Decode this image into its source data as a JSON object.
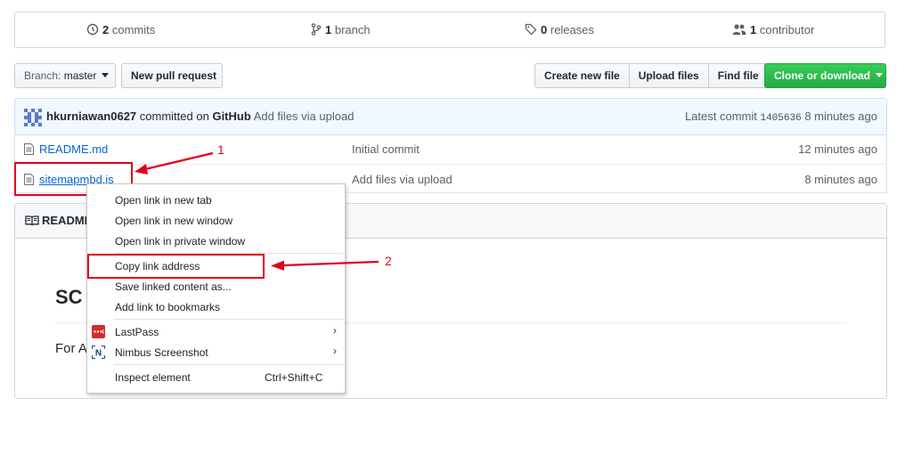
{
  "stats": {
    "commits_count": "2",
    "commits_label": "commits",
    "branches_count": "1",
    "branches_label": "branch",
    "releases_count": "0",
    "releases_label": "releases",
    "contributors_count": "1",
    "contributors_label": "contributor"
  },
  "toolbar": {
    "branch_prefix": "Branch:",
    "branch_name": "master",
    "new_pull_request": "New pull request",
    "create_new_file": "Create new file",
    "upload_files": "Upload files",
    "find_file": "Find file",
    "clone_or_download": "Clone or download"
  },
  "commit": {
    "author": "hkurniawan0627",
    "committed_on": "committed on",
    "platform": "GitHub",
    "message": "Add files via upload",
    "latest_label": "Latest commit",
    "sha": "1405636",
    "age": "8 minutes ago"
  },
  "files": [
    {
      "name": "README.md",
      "message": "Initial commit",
      "age": "12 minutes ago"
    },
    {
      "name": "sitemapmbd.js",
      "message": "Add files via upload",
      "age": "8 minutes ago"
    }
  ],
  "readme": {
    "header": "README",
    "heading_partial": "SC",
    "text_partial": "For A"
  },
  "context_menu": {
    "items": [
      "Open link in new tab",
      "Open link in new window",
      "Open link in private window",
      "Copy link address",
      "Save linked content as...",
      "Add link to bookmarks",
      "LastPass",
      "Nimbus Screenshot",
      "Inspect element"
    ],
    "inspect_shortcut": "Ctrl+Shift+C"
  },
  "annotations": {
    "label_1": "1",
    "label_2": "2",
    "color": "#e0001a"
  },
  "colors": {
    "link": "#0366d6",
    "green_button": "#28a745",
    "commit_bar": "#f1f8ff"
  }
}
